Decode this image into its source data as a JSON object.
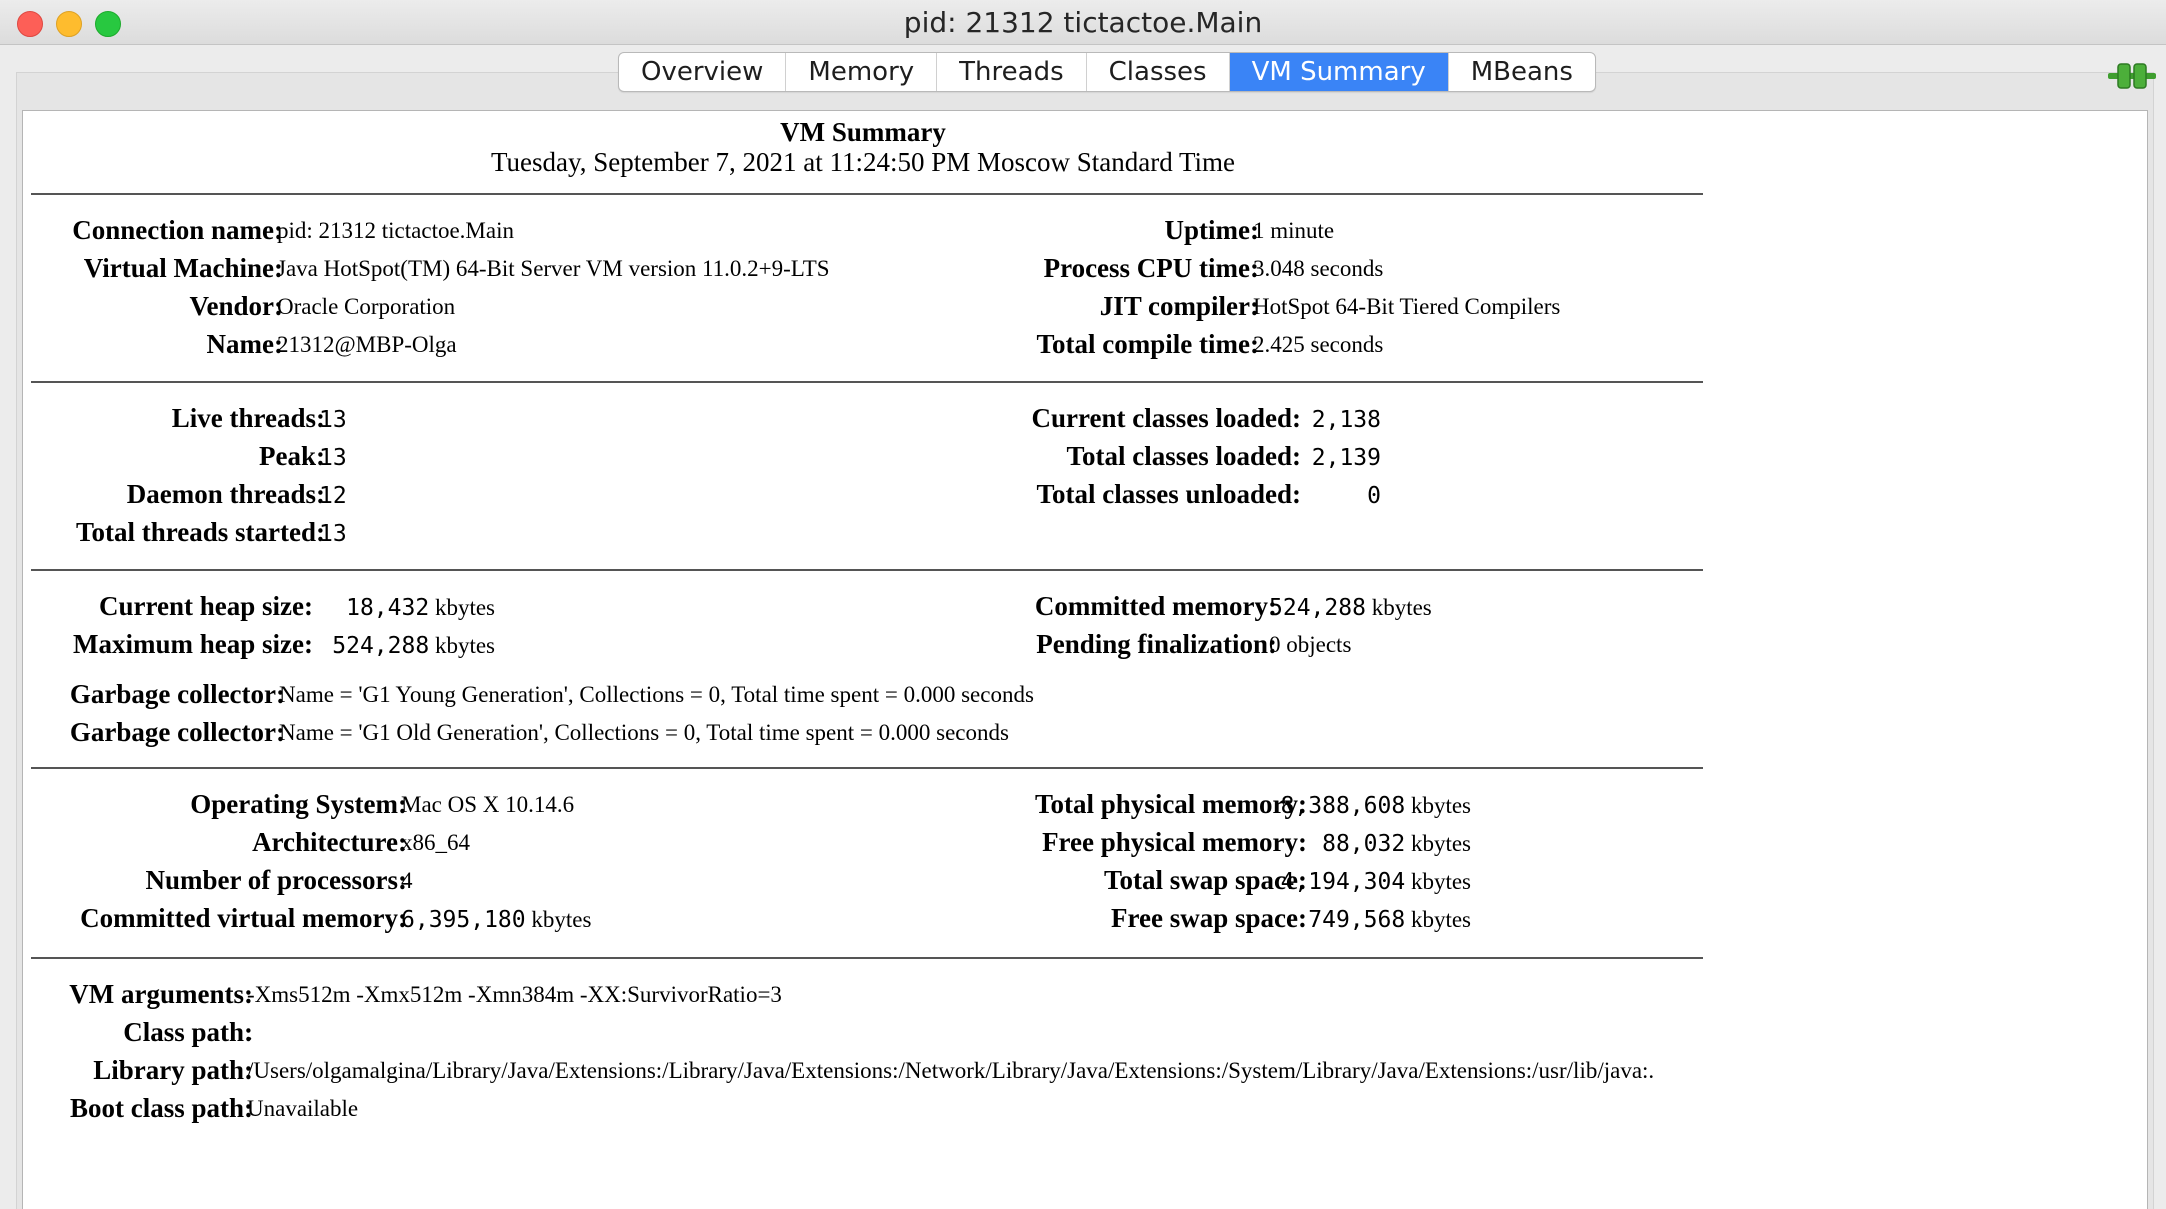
{
  "window": {
    "title": "pid: 21312 tictactoe.Main"
  },
  "tabs": [
    {
      "label": "Overview"
    },
    {
      "label": "Memory"
    },
    {
      "label": "Threads"
    },
    {
      "label": "Classes"
    },
    {
      "label": "VM Summary",
      "active": true
    },
    {
      "label": "MBeans"
    }
  ],
  "summary": {
    "title": "VM Summary",
    "date": "Tuesday, September 7, 2021 at 11:24:50 PM Moscow Standard Time"
  },
  "general": {
    "connection_label": "Connection name:",
    "connection": "pid: 21312 tictactoe.Main",
    "vm_label": "Virtual Machine:",
    "vm": "Java HotSpot(TM) 64-Bit Server VM version 11.0.2+9-LTS",
    "vendor_label": "Vendor:",
    "vendor": "Oracle Corporation",
    "name_label": "Name:",
    "name": "21312@MBP-Olga",
    "uptime_label": "Uptime:",
    "uptime": "1 minute",
    "cpu_label": "Process CPU time:",
    "cpu": "3.048 seconds",
    "jit_label": "JIT compiler:",
    "jit": "HotSpot 64-Bit Tiered Compilers",
    "compile_label": "Total compile time:",
    "compile": "2.425 seconds"
  },
  "threads": {
    "live_label": "Live threads:",
    "live": "13",
    "peak_label": "Peak:",
    "peak": "13",
    "daemon_label": "Daemon threads:",
    "daemon": "12",
    "started_label": "Total threads started:",
    "started": "13"
  },
  "classes": {
    "current_label": "Current classes loaded:",
    "current": "2,138",
    "total_label": "Total classes loaded:",
    "total": "2,139",
    "unloaded_label": "Total classes unloaded:",
    "unloaded": "0"
  },
  "memory": {
    "heap_label": "Current heap size:",
    "heap": "18,432",
    "max_heap_label": "Maximum heap size:",
    "max_heap": "524,288",
    "committed_label": "Committed memory:",
    "committed": "524,288",
    "pending_label": "Pending finalization:",
    "pending": "0 objects",
    "unit": "kbytes",
    "gc_label": "Garbage collector:",
    "gc1": "Name = 'G1 Young Generation', Collections = 0, Total time spent = 0.000 seconds",
    "gc2": "Name = 'G1 Old Generation', Collections = 0, Total time spent = 0.000 seconds"
  },
  "os": {
    "os_label": "Operating System:",
    "os": "Mac OS X 10.14.6",
    "arch_label": "Architecture:",
    "arch": "x86_64",
    "procs_label": "Number of processors:",
    "procs": "4",
    "cvm_label": "Committed virtual memory:",
    "cvm": "6,395,180",
    "tpm_label": "Total physical memory:",
    "tpm": "8,388,608",
    "fpm_label": "Free physical memory:",
    "fpm": "88,032",
    "tss_label": "Total swap space:",
    "tss": "4,194,304",
    "fss_label": "Free swap space:",
    "fss": "749,568"
  },
  "paths": {
    "args_label": "VM arguments:",
    "args": "-Xms512m -Xmx512m -Xmn384m -XX:SurvivorRatio=3",
    "cp_label": "Class path:",
    "cp": ".",
    "lib_label": "Library path:",
    "lib": "/Users/olgamalgina/Library/Java/Extensions:/Library/Java/Extensions:/Network/Library/Java/Extensions:/System/Library/Java/Extensions:/usr/lib/java:.",
    "boot_label": "Boot class path:",
    "boot": "Unavailable"
  }
}
